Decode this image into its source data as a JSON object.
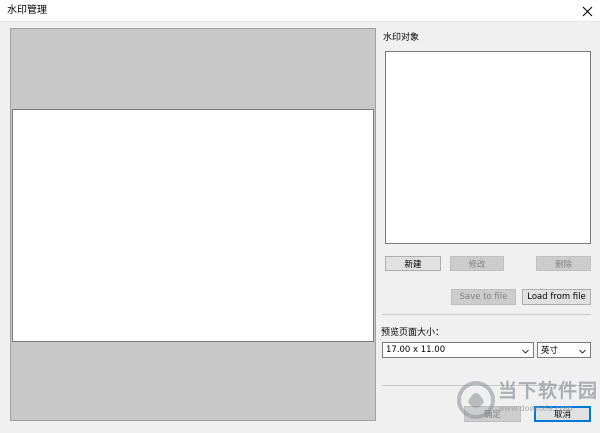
{
  "window": {
    "title": "水印管理",
    "close_glyph": "close-icon"
  },
  "objects": {
    "label": "水印对象",
    "items": []
  },
  "buttons": {
    "new": "新建",
    "modify": "修改",
    "delete": "删除",
    "save_to_file": "Save to file",
    "load_from_file": "Load from file",
    "ok": "确定",
    "cancel": "取消"
  },
  "preview_size": {
    "label": "预览页面大小：",
    "size_value": "17.00 x 11.00",
    "unit_value": "英寸"
  },
  "watermark": {
    "brand": "当下软件园",
    "url": "www.downxia.com"
  },
  "colors": {
    "accent": "#0078d7",
    "preview_bg": "#c8c8c8"
  }
}
